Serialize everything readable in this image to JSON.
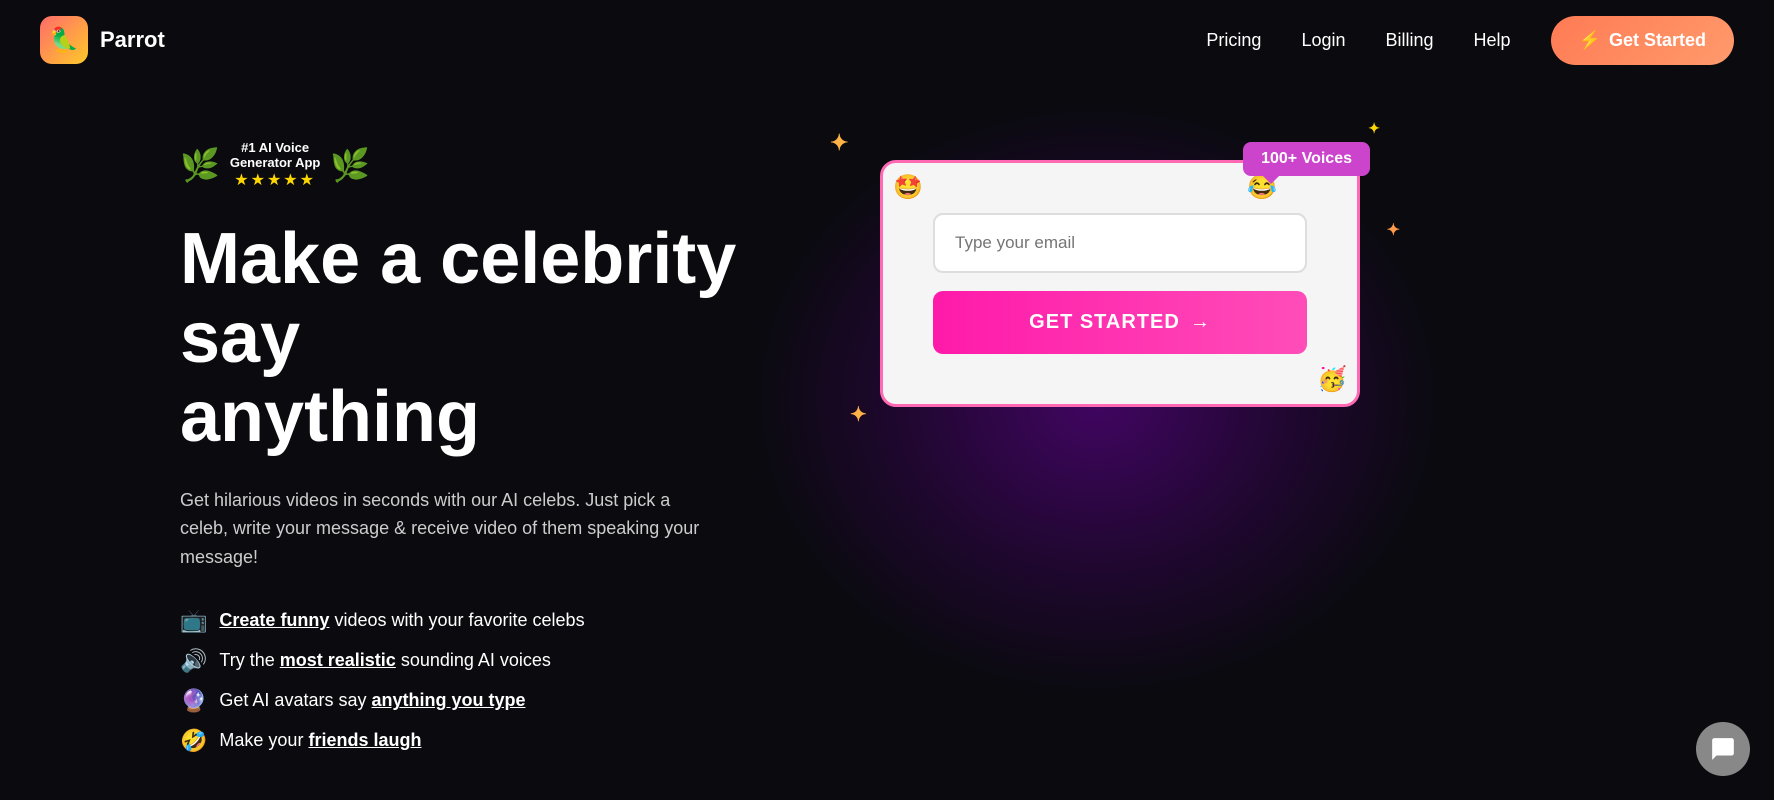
{
  "nav": {
    "logo_text": "Parrot",
    "logo_emoji": "🦜",
    "links": [
      {
        "label": "Pricing",
        "id": "pricing"
      },
      {
        "label": "Login",
        "id": "login"
      },
      {
        "label": "Billing",
        "id": "billing"
      },
      {
        "label": "Help",
        "id": "help"
      }
    ],
    "cta_label": "Get Started",
    "cta_icon": "⚡"
  },
  "hero": {
    "award": {
      "title": "#1 AI Voice",
      "subtitle": "Generator App",
      "stars": "★★★★★"
    },
    "headline_line1": "Make a celebrity say",
    "headline_line2": "anything",
    "subtext": "Get hilarious videos in seconds with our AI celebs. Just pick a celeb, write your message & receive video of them speaking your message!",
    "features": [
      {
        "icon": "📺",
        "text_before": "",
        "link_text": "Create funny",
        "text_after": " videos with your favorite celebs"
      },
      {
        "icon": "🔊",
        "text_before": "Try the ",
        "link_text": "most realistic",
        "text_after": " sounding AI voices"
      },
      {
        "icon": "🔮",
        "text_before": "Get AI avatars say ",
        "link_text": "anything you type",
        "text_after": ""
      },
      {
        "icon": "🤣",
        "text_before": "Make your ",
        "link_text": "friends laugh",
        "text_after": ""
      }
    ]
  },
  "signup_card": {
    "voices_badge": "100+ Voices",
    "email_placeholder": "Type your email",
    "cta_label": "GET STARTED",
    "cta_arrow": "→",
    "decorative_emojis": [
      "🤩",
      "😂",
      "🥳"
    ]
  },
  "chat": {
    "icon": "💬"
  }
}
